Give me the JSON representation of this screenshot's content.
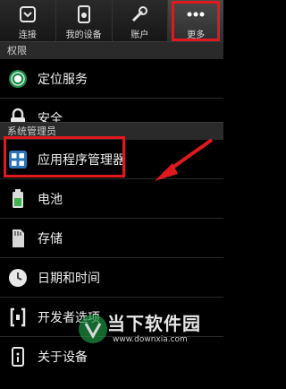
{
  "tabs": [
    {
      "label": "连接",
      "icon": "connections-icon",
      "active": false
    },
    {
      "label": "我的设备",
      "icon": "my-device-icon",
      "active": false
    },
    {
      "label": "账户",
      "icon": "accounts-icon",
      "active": false
    },
    {
      "label": "更多",
      "icon": "more-icon",
      "active": true
    }
  ],
  "sections": {
    "permissions": "权限",
    "system": "系统管理员"
  },
  "items": [
    {
      "label": "定位服务",
      "icon": "location-icon"
    },
    {
      "label": "安全",
      "icon": "lock-icon"
    },
    {
      "label": "应用程序管理器",
      "icon": "app-manager-icon"
    },
    {
      "label": "电池",
      "icon": "battery-icon"
    },
    {
      "label": "存储",
      "icon": "storage-icon"
    },
    {
      "label": "日期和时间",
      "icon": "clock-icon"
    },
    {
      "label": "开发者选项",
      "icon": "developer-icon"
    },
    {
      "label": "关于设备",
      "icon": "device-info-icon"
    }
  ],
  "watermark": {
    "title": "当下软件园",
    "url": "www.downxia.com"
  },
  "colors": {
    "highlight": "#e0191e",
    "accent": "#1aa0e0",
    "location_green": "#1f8a4c"
  }
}
